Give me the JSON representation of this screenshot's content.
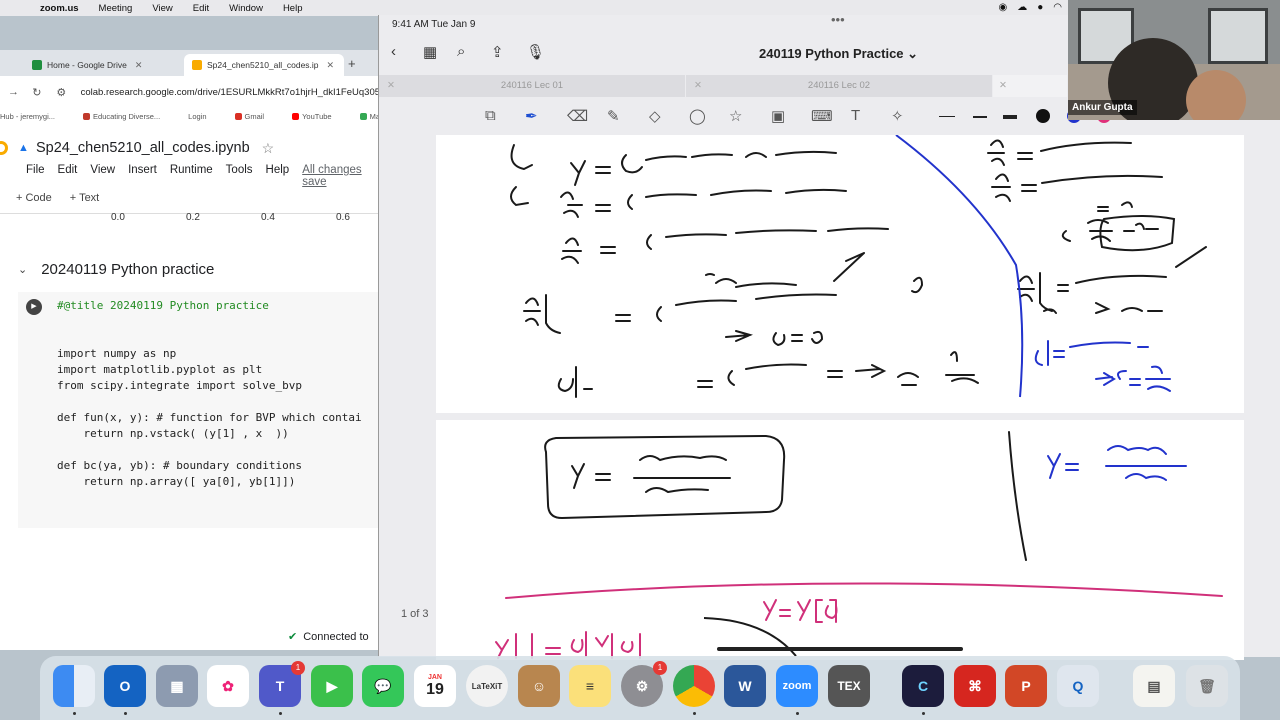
{
  "menubar": {
    "app": "zoom.us",
    "items": [
      "Meeting",
      "View",
      "Edit",
      "Window",
      "Help"
    ]
  },
  "browser": {
    "tabs": [
      {
        "label": "Home - Google Drive",
        "color": "#1e8e3e"
      },
      {
        "label": "Sp24_chen5210_all_codes.ip",
        "color": "#f9ab00"
      }
    ],
    "url": "colab.research.google.com/drive/1ESURLMkkRt7o1hjrH_dkI1FeUq305",
    "bookmarks": [
      {
        "label": "Hub - jeremygi...",
        "color": "#888888"
      },
      {
        "label": "Educating Diverse...",
        "color": "#c0392b"
      },
      {
        "label": "Login",
        "color": "#888888"
      },
      {
        "label": "Gmail",
        "color": "#d93025"
      },
      {
        "label": "YouTube",
        "color": "#ff0000"
      },
      {
        "label": "Maps",
        "color": "#34a853"
      }
    ]
  },
  "colab": {
    "notebook_name": "Sp24_chen5210_all_codes.ipynb",
    "menus": [
      "File",
      "Edit",
      "View",
      "Insert",
      "Runtime",
      "Tools",
      "Help"
    ],
    "save_status": "All changes save",
    "toolbar": [
      "+ Code",
      "+ Text"
    ],
    "axis_ticks": [
      "0.0",
      "0.2",
      "0.4",
      "0.6"
    ],
    "section_title": "20240119 Python practice",
    "code_lines": [
      {
        "text": "#@title 20240119 Python practice",
        "kind": "cmt"
      },
      {
        "text": "",
        "kind": "plain"
      },
      {
        "text": "",
        "kind": "plain"
      },
      {
        "text": "import numpy as np",
        "kind": "plain"
      },
      {
        "text": "import matplotlib.pyplot as plt",
        "kind": "plain"
      },
      {
        "text": "from scipy.integrate import solve_bvp",
        "kind": "plain"
      },
      {
        "text": "",
        "kind": "plain"
      },
      {
        "text": "def fun(x, y): # function for BVP which contai",
        "kind": "plain"
      },
      {
        "text": "    return np.vstack( (y[1] , x  ))",
        "kind": "plain"
      },
      {
        "text": "",
        "kind": "plain"
      },
      {
        "text": "def bc(ya, yb): # boundary conditions",
        "kind": "plain"
      },
      {
        "text": "    return np.array([ ya[0], yb[1]])",
        "kind": "plain"
      }
    ],
    "connection_status": "Connected to"
  },
  "ipad": {
    "time": "9:41 AM  Tue Jan 9",
    "doc_title": "240119 Python Practice ⌄",
    "doc_tabs": [
      "240116 Lec 01",
      "240116 Lec 02"
    ],
    "page_indicator": "1 of 3",
    "pen_colors": [
      "#111111",
      "#2233cc",
      "#e0307a"
    ]
  },
  "video": {
    "participant": "Ankur Gupta"
  },
  "dock": {
    "calendar_month": "JAN",
    "calendar_day": "19",
    "teams_badge": "1",
    "settings_badge": "1",
    "zoom_label": "zoom",
    "texmaker_label": "TEX",
    "latexit_label": "LaTeXiT"
  }
}
